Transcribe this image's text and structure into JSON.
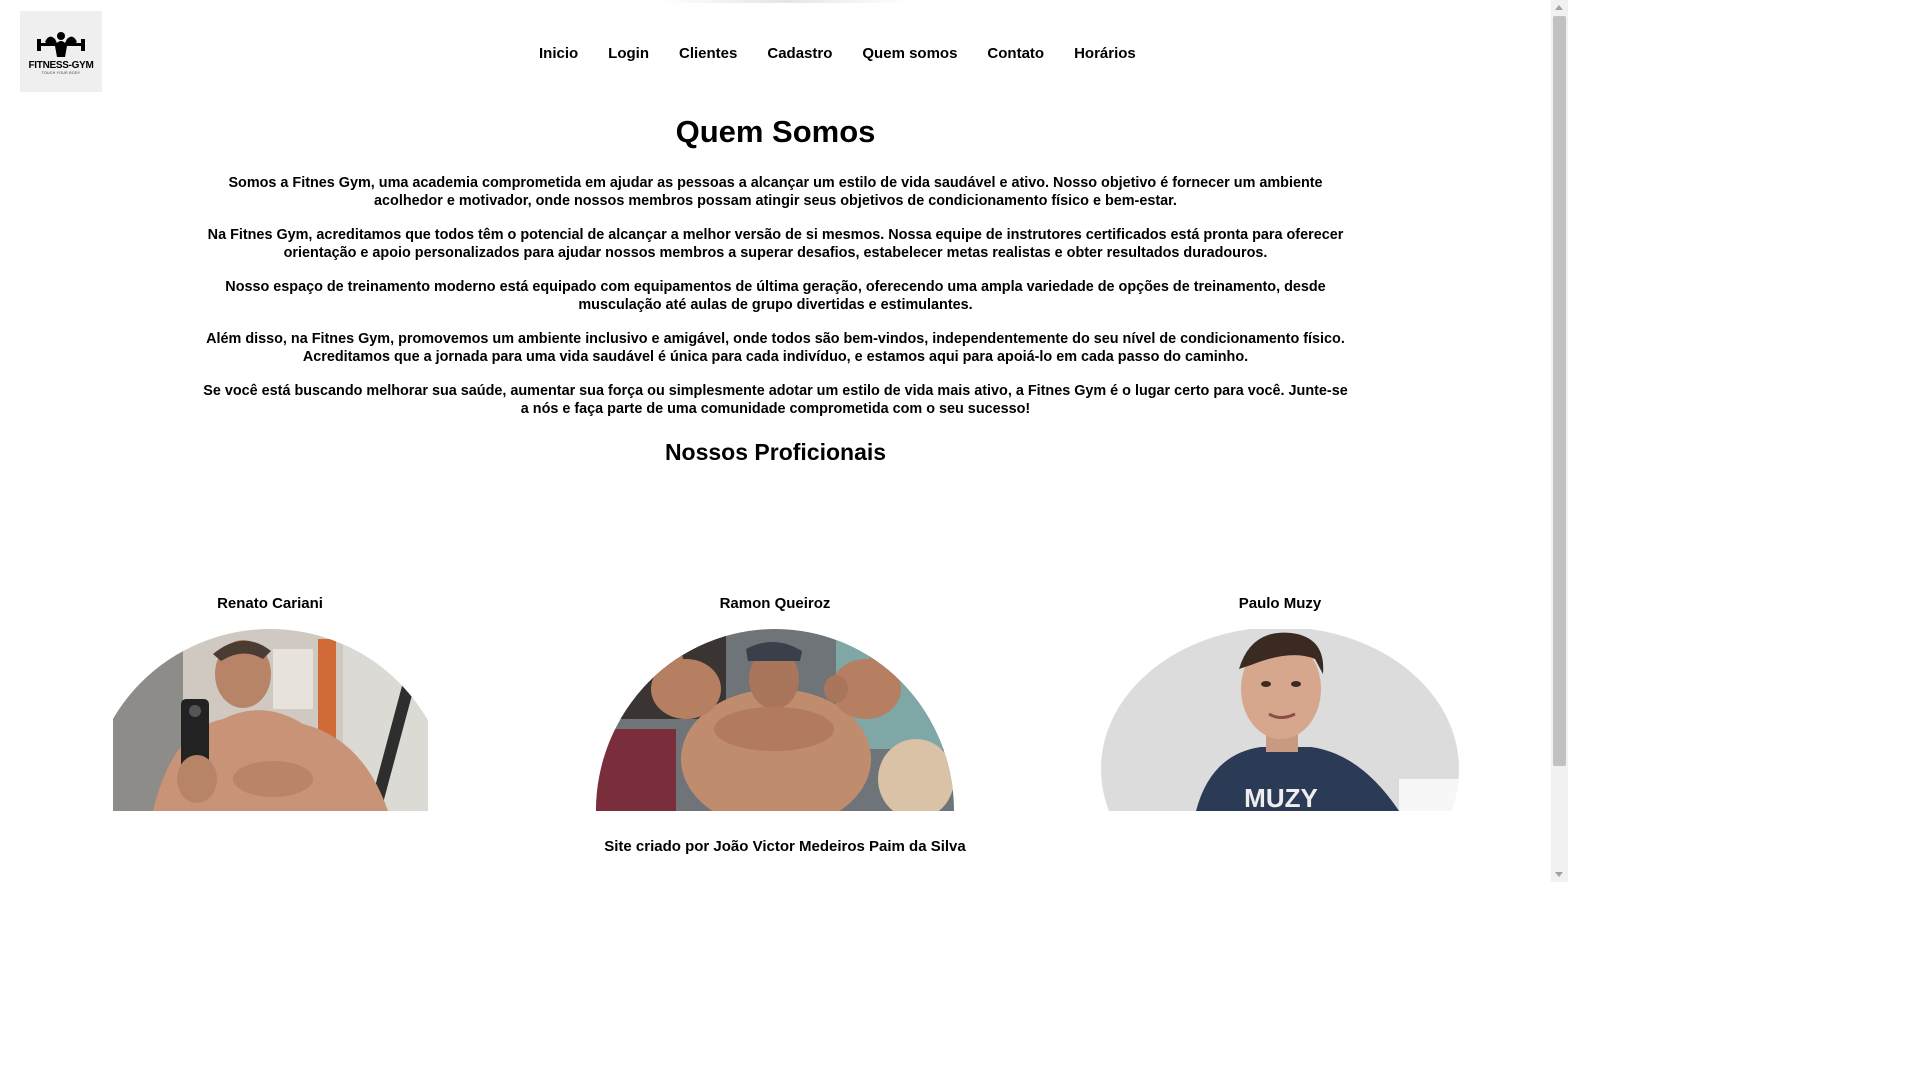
{
  "logo": {
    "brand": "FITNESS-GYM",
    "tagline": "TOUCH YOUR BODY"
  },
  "nav": [
    "Inicio",
    "Login",
    "Clientes",
    "Cadastro",
    "Quem somos",
    "Contato",
    "Horários"
  ],
  "about": {
    "title": "Quem Somos",
    "paragraphs": [
      "Somos a Fitnes Gym, uma academia comprometida em ajudar as pessoas a alcançar um estilo de vida saudável e ativo. Nosso objetivo é fornecer um ambiente acolhedor e motivador, onde nossos membros possam atingir seus objetivos de condicionamento físico e bem-estar.",
      "Na Fitnes Gym, acreditamos que todos têm o potencial de alcançar a melhor versão de si mesmos. Nossa equipe de instrutores certificados está pronta para oferecer orientação e apoio personalizados para ajudar nossos membros a superar desafios, estabelecer metas realistas e obter resultados duradouros.",
      "Nosso espaço de treinamento moderno está equipado com equipamentos de última geração, oferecendo uma ampla variedade de opções de treinamento, desde musculação até aulas de grupo divertidas e estimulantes.",
      "Além disso, na Fitnes Gym, promovemos um ambiente inclusivo e amigável, onde todos são bem-vindos, independentemente do seu nível de condicionamento físico. Acreditamos que a jornada para uma vida saudável é única para cada indivíduo, e estamos aqui para apoiá-lo em cada passo do caminho.",
      "Se você está buscando melhorar sua saúde, aumentar sua força ou simplesmente adotar um estilo de vida mais ativo, a Fitnes Gym é o lugar certo para você. Junte-se a nós e faça parte de uma comunidade comprometida com o seu sucesso!"
    ]
  },
  "professionals": {
    "title": "Nossos Proficionais",
    "people": [
      "Renato Cariani",
      "Ramon Queiroz",
      "Paulo Muzy"
    ]
  },
  "photos": {
    "muzy_shirt_text": "MUZY"
  },
  "footer": "Site criado por João Victor Medeiros Paim da Silva"
}
